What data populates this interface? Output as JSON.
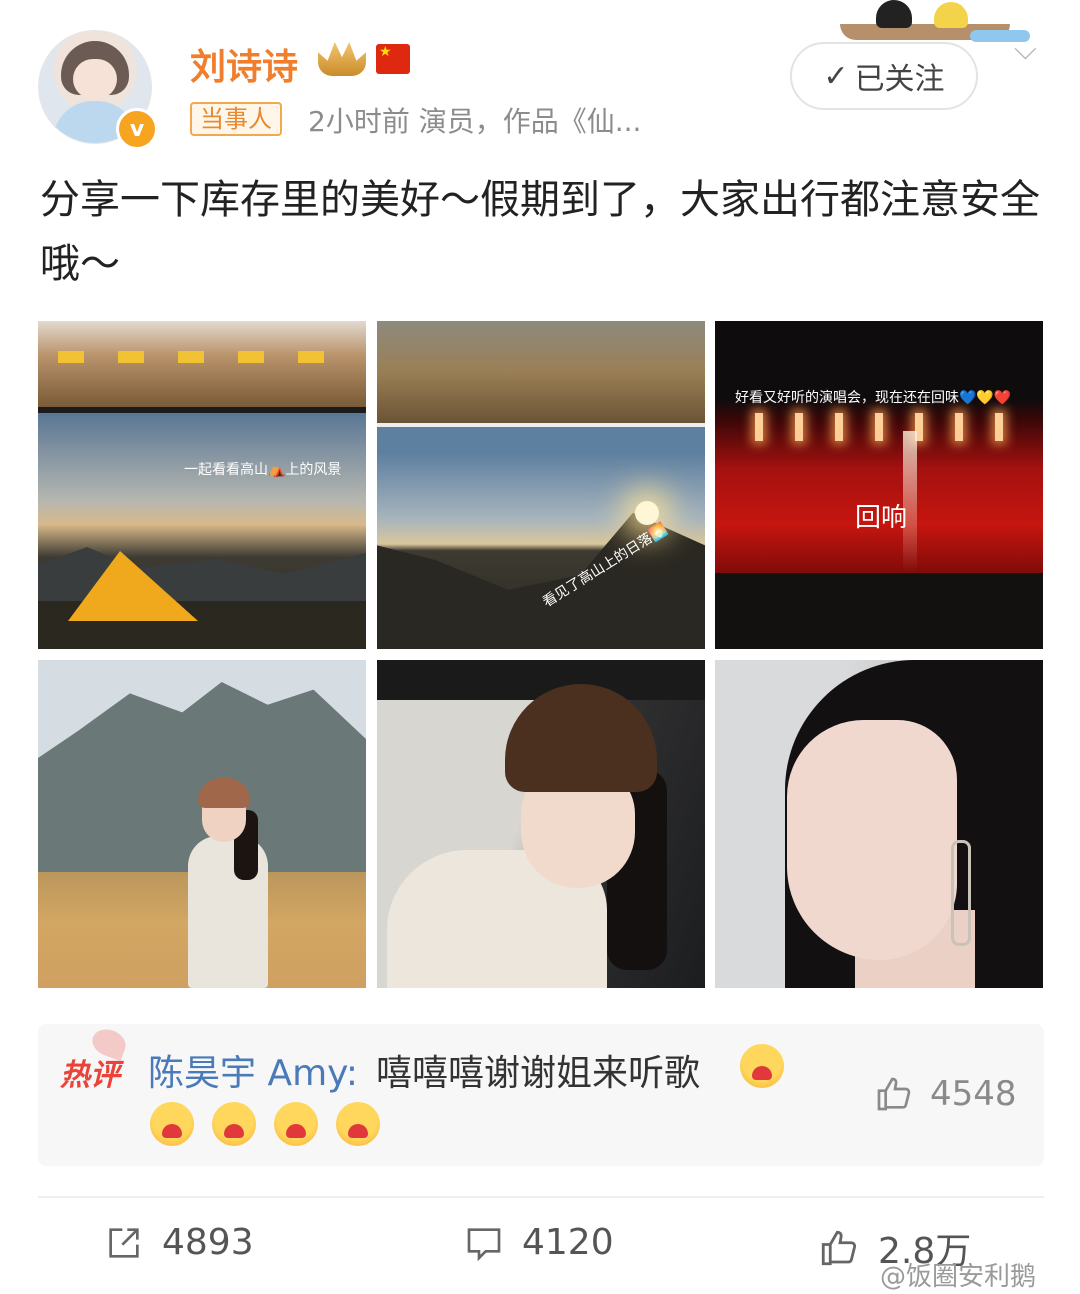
{
  "user": {
    "name": "刘诗诗",
    "verified_badge": "v",
    "tag": "当事人",
    "meta": "2小时前  演员，作品《仙...",
    "crown_icon": "crown-badge-icon",
    "flag_icon": "china-flag-icon"
  },
  "follow": {
    "label": "已关注"
  },
  "post": {
    "text": "分享一下库存里的美好～假期到了，大家出行都注意安全哦～"
  },
  "images": [
    {
      "caption": "一起看看高山⛺上的风景"
    },
    {
      "caption": "看见了高山上的日落🌅"
    },
    {
      "caption": "好看又好听的演唱会，现在还在回味💙💛❤️",
      "stage_mark": "回响"
    },
    {
      "caption": ""
    },
    {
      "caption": ""
    },
    {
      "caption": ""
    }
  ],
  "hot_comment": {
    "label": "热评",
    "author": "陈昊宇 Amy",
    "separator": ":",
    "text": "嘻嘻嘻谢谢姐来听歌",
    "emoji_icon": "hug-emoji-icon",
    "likes": "4548"
  },
  "actions": {
    "repost": "4893",
    "comment": "4120",
    "like": "2.8万"
  },
  "watermark": "@饭圈安利鹅",
  "colors": {
    "username": "#f07e2c",
    "hot_label": "#e9433a",
    "author_link": "#4a7bb8",
    "tag_border": "#f2a94d"
  }
}
